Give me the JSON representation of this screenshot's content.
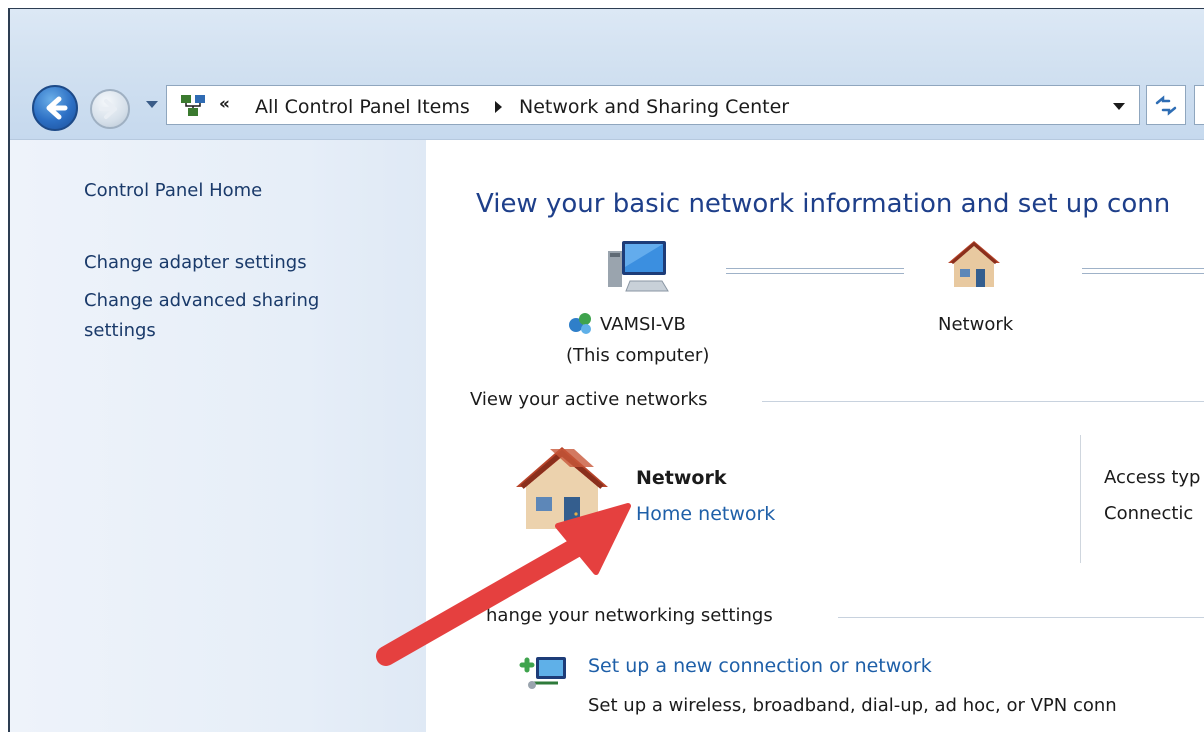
{
  "address_bar": {
    "overflow_chevrons": "«",
    "segments": [
      "All Control Panel Items",
      "Network and Sharing Center"
    ]
  },
  "sidebar": {
    "items": [
      {
        "label": "Control Panel Home"
      },
      {
        "label": "Change adapter settings"
      },
      {
        "label": "Change advanced sharing settings"
      }
    ]
  },
  "main": {
    "title": "View your basic network information and set up conn",
    "network_map": {
      "computer_name": "VAMSI-VB",
      "computer_sub": "(This computer)",
      "network_label": "Network"
    },
    "active_networks": {
      "heading": "View your active networks",
      "network_name": "Network",
      "network_type": "Home network",
      "access_type_label": "Access typ",
      "connections_label": "Connectic"
    },
    "change_settings": {
      "heading": "hange your networking settings",
      "setup_link": "Set up a new connection or network",
      "setup_desc": "Set up a wireless, broadband, dial-up, ad hoc, or VPN conn"
    }
  },
  "annotation": {
    "arrow_color": "#e5403f"
  }
}
